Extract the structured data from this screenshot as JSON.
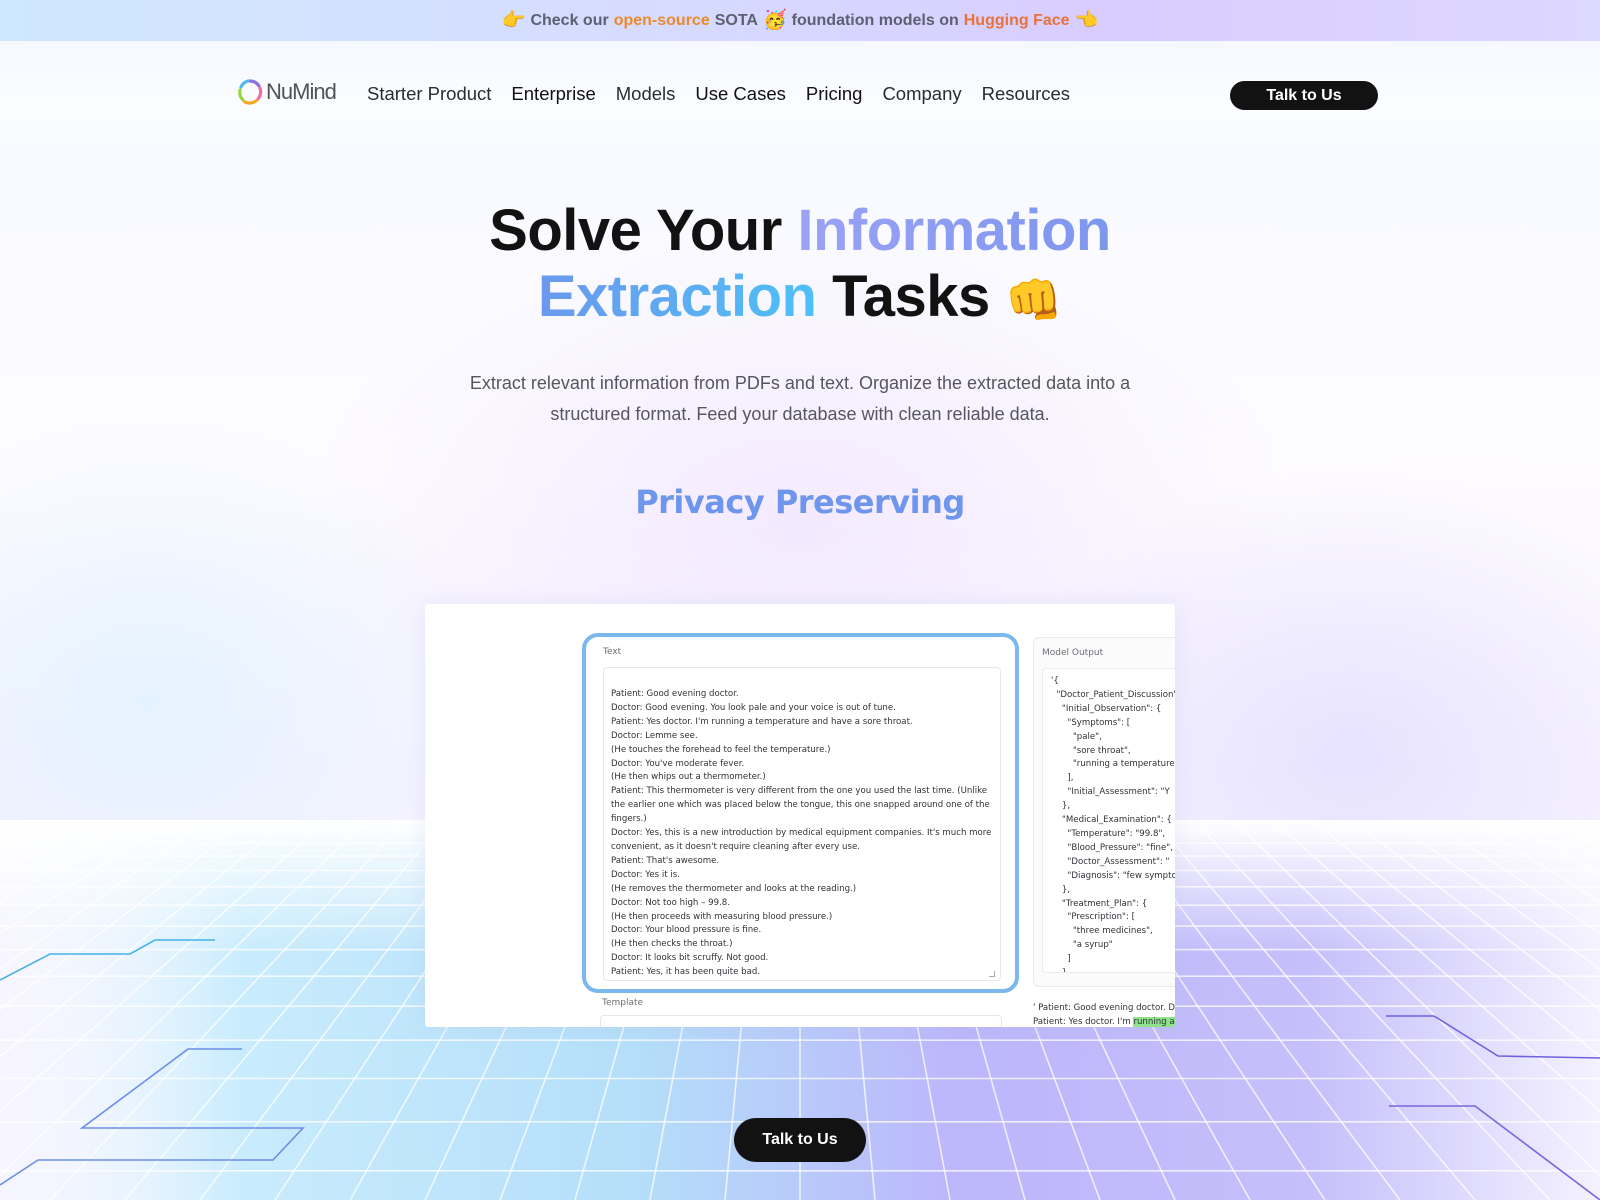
{
  "announcement": {
    "emoji_left": "👉",
    "text_1": "Check our",
    "link_1": "open-source",
    "text_2": "SOTA",
    "emoji_mid": "🥳",
    "text_3": "foundation models on",
    "link_2": "Hugging Face",
    "emoji_right": "👈"
  },
  "nav": {
    "logo_text": "NuMind",
    "links": [
      "Starter Product",
      "Enterprise",
      "Models",
      "Use Cases",
      "Pricing",
      "Company",
      "Resources"
    ],
    "cta_label": "Talk to Us"
  },
  "hero": {
    "title_part_1": "Solve Your ",
    "title_highlight_1": "Information",
    "title_highlight_2": "Extraction",
    "title_part_2": " Tasks ",
    "title_emoji": "👊",
    "subtitle": "Extract relevant information from PDFs and text. Organize the extracted data into a structured format. Feed your database with clean reliable data.",
    "rotating_tag": "Privacy Preserving"
  },
  "demo": {
    "text_label": "Text",
    "text_lines": [
      "Patient: Good evening doctor.",
      "Doctor: Good evening. You look pale and your voice is out of tune.",
      "Patient: Yes doctor. I'm running a temperature and have a sore throat.",
      "Doctor: Lemme see.",
      "(He touches the forehead to feel the temperature.)",
      "Doctor: You've moderate fever.",
      "(He then whips out a thermometer.)",
      "Patient: This thermometer is very different from the one you used the last time. (Unlike the earlier one which was placed below the tongue, this one snapped around one of the fingers.)",
      "Doctor: Yes, this is a new introduction by medical equipment companies. It's much more convenient, as it doesn't require cleaning after every use.",
      "Patient: That's awesome.",
      "Doctor: Yes it is.",
      "(He removes the thermometer and looks at the reading.)",
      "Doctor: Not too high – 99.8.",
      "(He then proceeds with measuring blood pressure.)",
      "Doctor: Your blood pressure is fine.",
      "(He then checks the throat.)",
      "Doctor: It looks bit scruffy. Not good.",
      "Patient: Yes, it has been quite bad."
    ],
    "template_label": "Template",
    "output_label": "Model Output",
    "output_lines": [
      "'{",
      "  \"Doctor_Patient_Discussion\": {",
      "    \"Initial_Observation\": {",
      "      \"Symptoms\": [",
      "        \"pale\",",
      "        \"sore throat\",",
      "        \"running a temperature\"",
      "      ],",
      "      \"Initial_Assessment\": \"Y",
      "    },",
      "    \"Medical_Examination\": {",
      "      \"Temperature\": \"99.8\",",
      "      \"Blood_Pressure\": \"fine\",",
      "      \"Doctor_Assessment\": \"",
      "      \"Diagnosis\": \"few symptoms",
      "    },",
      "    \"Treatment_Plan\": {",
      "      \"Prescription\": [",
      "        \"three medicines\",",
      "        \"a syrup\"",
      "      ]",
      "    }"
    ],
    "highlight_line_1": "' Patient: Good evening doctor. Doctor:",
    "highlight_line_2_prefix": "Patient: Yes doctor. I'm ",
    "highlight_line_2_mark": "running a temperature"
  },
  "bottom_cta_label": "Talk to Us",
  "colors": {
    "accent_blue": "#6e96ec",
    "accent_orange": "#ea8a2c",
    "cta_bg": "#121212",
    "demo_border": "#7ab8ee",
    "highlight_green": "#8ee28a"
  }
}
